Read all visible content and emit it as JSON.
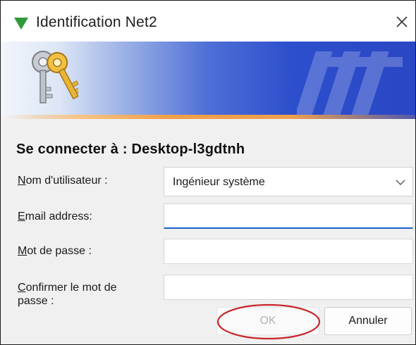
{
  "window": {
    "title": "Identification Net2"
  },
  "connect_label": "Se connecter à : Desktop-l3gdtnh",
  "fields": {
    "username": {
      "label_accel": "N",
      "label_rest": "om d'utilisateur :",
      "value": "Ingénieur système"
    },
    "email": {
      "label_accel": "E",
      "label_rest": "mail address:",
      "value": ""
    },
    "password": {
      "label_accel": "M",
      "label_rest": "ot de passe :",
      "value": ""
    },
    "confirm": {
      "label_accel": "C",
      "label_rest": "onfirmer le mot de",
      "label_line2": "passe :",
      "value": ""
    }
  },
  "buttons": {
    "ok": "OK",
    "cancel": "Annuler"
  },
  "colors": {
    "accent": "#1b64c8",
    "annotation": "#c8262b",
    "app_icon": "#2f9a3a"
  },
  "icons": {
    "app": "green-triangle-icon",
    "close": "close-icon",
    "banner": "keys-icon",
    "dropdown": "chevron-down-icon"
  }
}
